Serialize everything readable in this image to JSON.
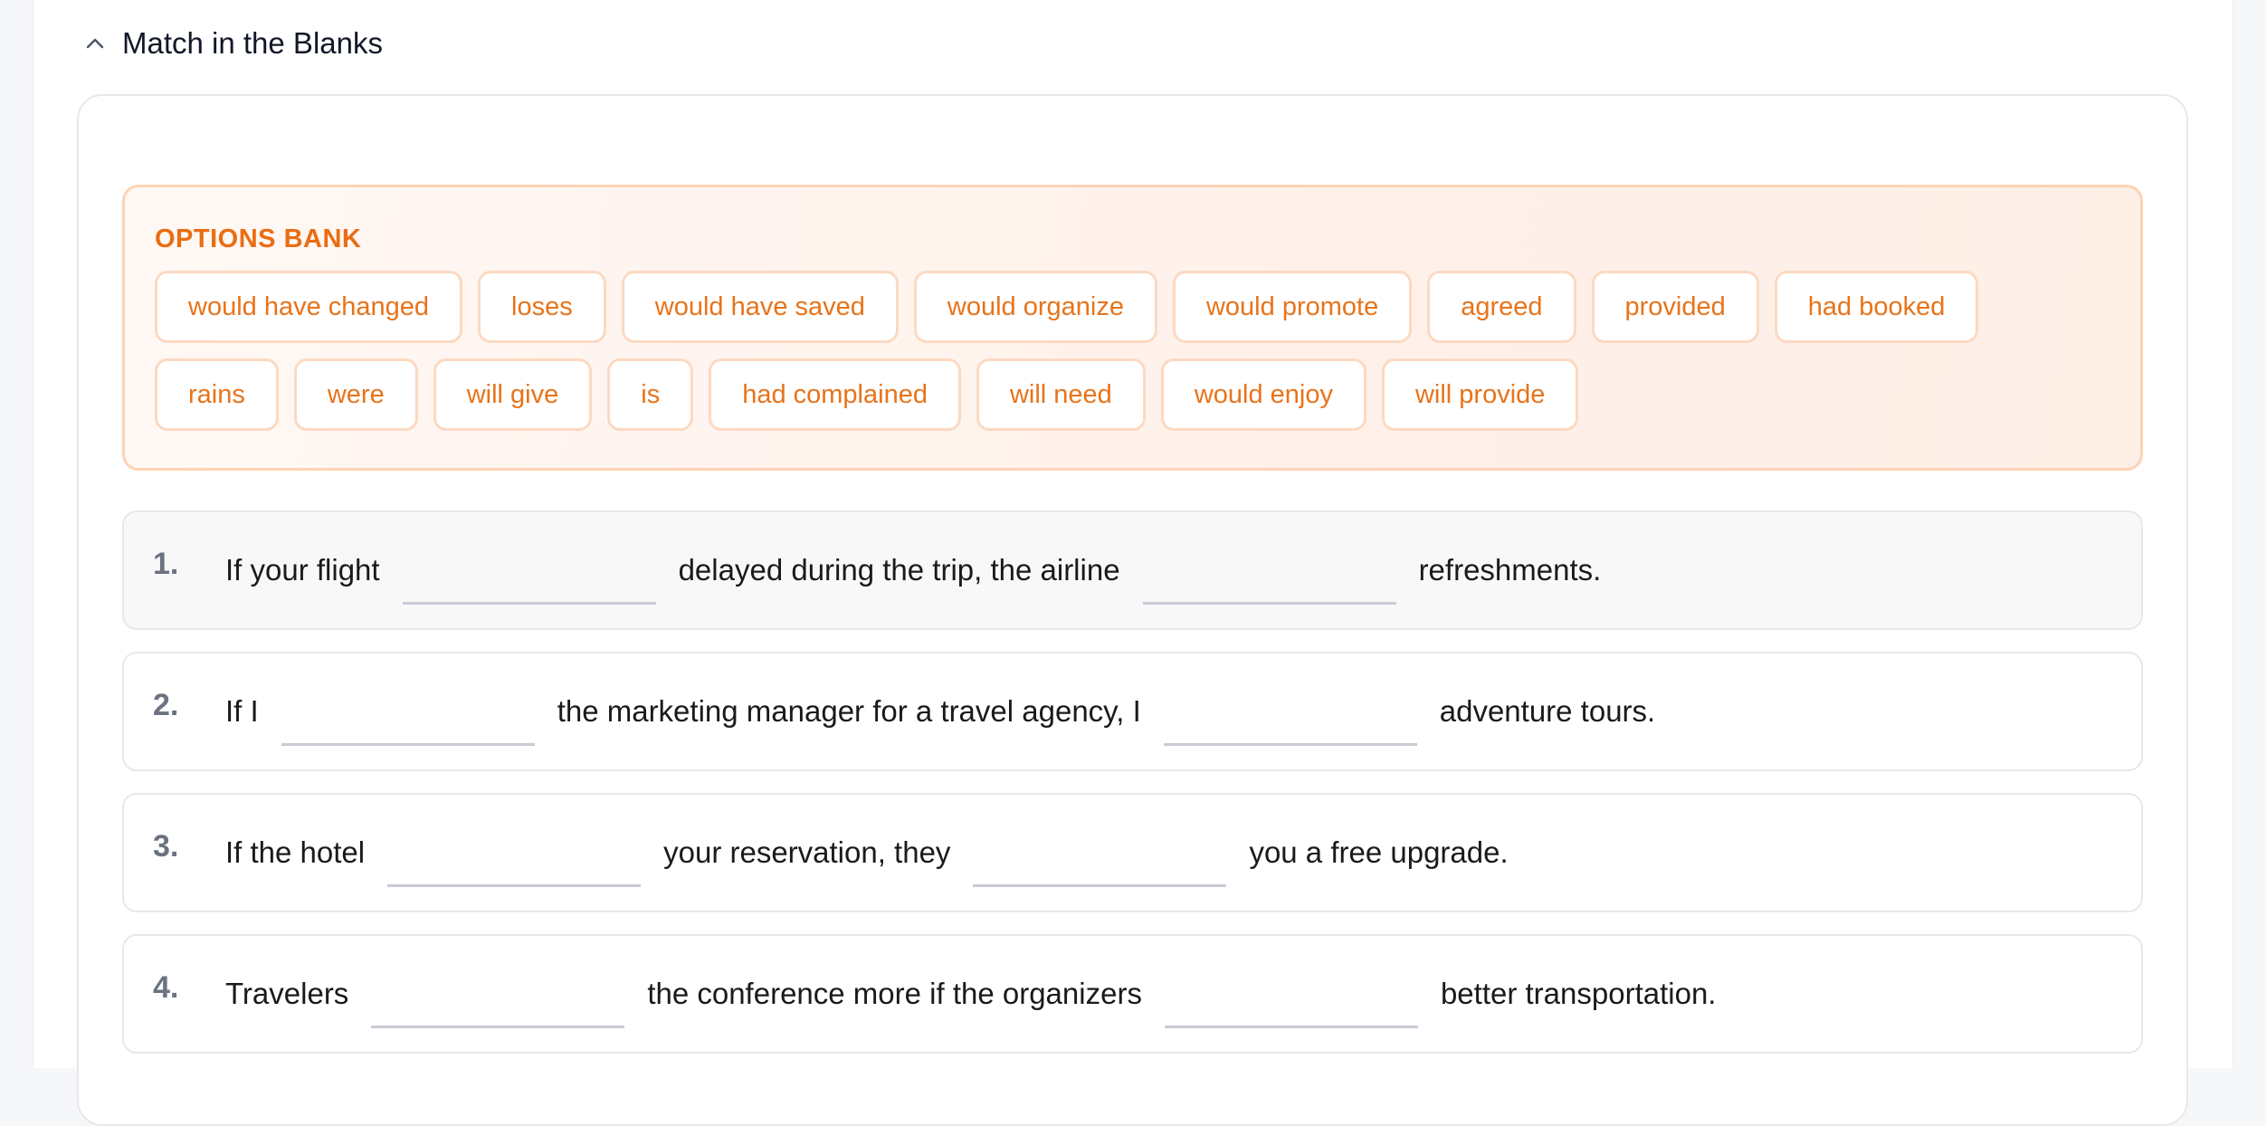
{
  "section": {
    "title": "Match in the Blanks",
    "chevron_icon": "chevron-up-icon"
  },
  "bank": {
    "title": "OPTIONS BANK",
    "options": [
      "would have changed",
      "loses",
      "would have saved",
      "would organize",
      "would promote",
      "agreed",
      "provided",
      "had booked",
      "rains",
      "were",
      "will give",
      "is",
      "had complained",
      "will need",
      "would enjoy",
      "will provide"
    ]
  },
  "questions": [
    {
      "number": "1.",
      "parts": [
        "If your flight",
        "delayed during the trip, the airline",
        "refreshments."
      ]
    },
    {
      "number": "2.",
      "parts": [
        "If I",
        "the marketing manager for a travel agency, I",
        "adventure tours."
      ]
    },
    {
      "number": "3.",
      "parts": [
        "If the hotel",
        "your reservation, they",
        "you a free upgrade."
      ]
    },
    {
      "number": "4.",
      "parts": [
        "Travelers",
        "the conference more if the organizers",
        "better transportation."
      ]
    }
  ],
  "colors": {
    "accent": "#ea6d12",
    "chip_border": "#fcd9c2",
    "bank_bg": "#fff3ec"
  }
}
